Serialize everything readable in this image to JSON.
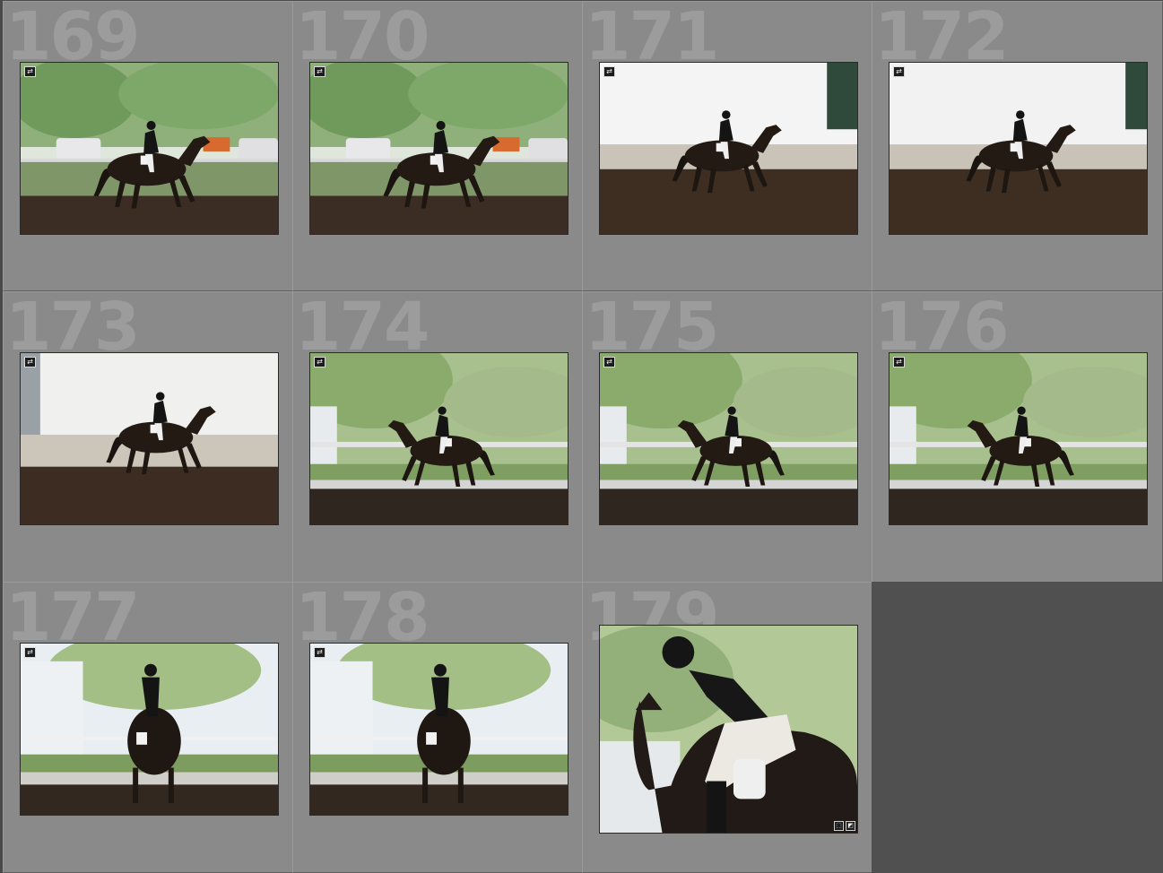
{
  "grid": {
    "cells": [
      {
        "number": "169",
        "scene": "outdoor",
        "badge_icon": "sync-arrows-icon"
      },
      {
        "number": "170",
        "scene": "outdoor",
        "badge_icon": "sync-arrows-icon"
      },
      {
        "number": "171",
        "scene": "indoor",
        "badge_icon": "sync-arrows-icon"
      },
      {
        "number": "172",
        "scene": "indoor",
        "badge_icon": "sync-arrows-icon"
      },
      {
        "number": "173",
        "scene": "indoor",
        "badge_icon": "sync-arrows-icon"
      },
      {
        "number": "174",
        "scene": "birch",
        "badge_icon": "sync-arrows-icon"
      },
      {
        "number": "175",
        "scene": "birch",
        "badge_icon": "sync-arrows-icon"
      },
      {
        "number": "176",
        "scene": "birch",
        "badge_icon": "sync-arrows-icon"
      },
      {
        "number": "177",
        "scene": "rear",
        "badge_icon": "sync-arrows-icon"
      },
      {
        "number": "178",
        "scene": "rear",
        "badge_icon": "sync-arrows-icon"
      },
      {
        "number": "179",
        "scene": "closeup",
        "badge_icons": [
          "crop-icon",
          "adjust-icon"
        ]
      }
    ]
  }
}
